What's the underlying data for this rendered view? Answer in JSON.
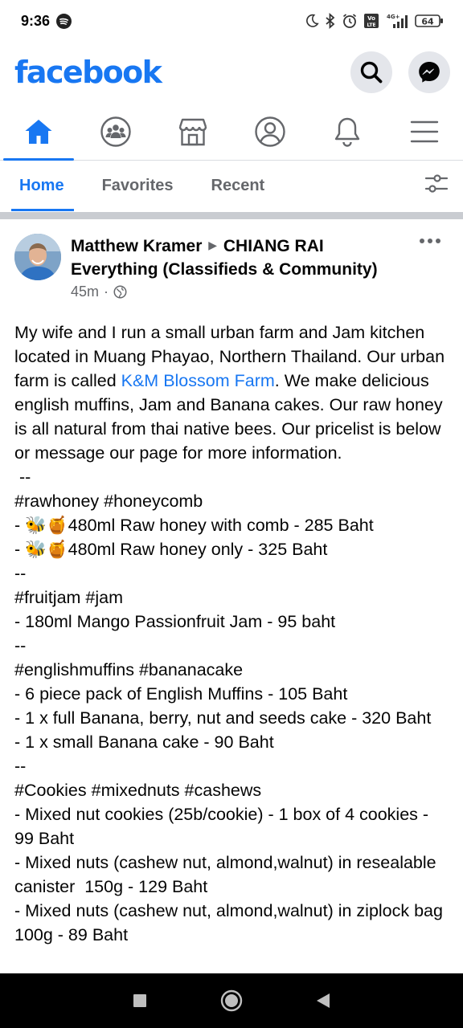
{
  "status_bar": {
    "time": "9:36",
    "network": "4G+",
    "volte": "Vo LTE",
    "battery": "64"
  },
  "header": {
    "logo": "facebook",
    "search_icon": "search-icon",
    "messenger_icon": "messenger-icon",
    "brand_color": "#1877f2"
  },
  "nav": {
    "items": [
      "home-icon",
      "groups-icon",
      "marketplace-icon",
      "profile-icon",
      "notifications-icon",
      "menu-icon"
    ],
    "active": "home-icon"
  },
  "feed_tabs": {
    "home": "Home",
    "favorites": "Favorites",
    "recent": "Recent"
  },
  "post": {
    "author": "Matthew Kramer",
    "group": "CHIANG RAI Everything (Classifieds & Community)",
    "time": "45m",
    "privacy_icon": "globe-icon",
    "body_intro_1": "My wife and I run a small urban farm and Jam kitchen located in Muang Phayao, Northern Thailand. Our urban farm is called ",
    "body_link": "K&M Blossom Farm",
    "body_intro_2": ". We make delicious english muffins, Jam and Banana cakes. Our raw honey is all natural from thai native bees. Our pricelist is below or message our page for more information.",
    "lines": [
      " --",
      "#rawhoney #honeycomb",
      "- 🐝🍯480ml Raw honey with comb - 285 Baht",
      "- 🐝🍯480ml Raw honey only - 325 Baht",
      "--",
      "#fruitjam #jam",
      "- 180ml Mango Passionfruit Jam - 95 baht",
      "--",
      "#englishmuffins #bananacake",
      "- 6 piece pack of English Muffins - 105 Baht",
      "- 1 x full Banana, berry, nut and seeds cake - 320 Baht",
      "- 1 x small Banana cake - 90 Baht",
      "--",
      "#Cookies #mixednuts #cashews",
      "- Mixed nut cookies (25b/cookie) - 1 box of 4 cookies - 99 Baht",
      "- Mixed nuts (cashew nut, almond,walnut) in resealable canister  150g - 129 Baht",
      "- Mixed nuts (cashew nut, almond,walnut) in ziplock bag 100g - 89 Baht"
    ]
  }
}
